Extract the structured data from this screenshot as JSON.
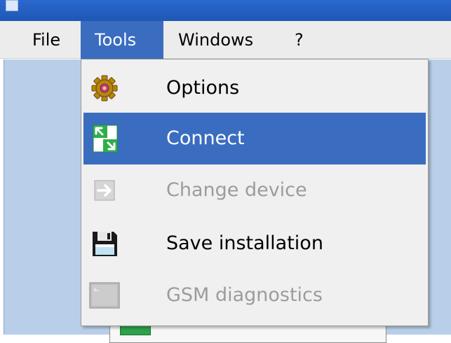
{
  "menubar": {
    "items": [
      {
        "label": "File"
      },
      {
        "label": "Tools"
      },
      {
        "label": "Windows"
      },
      {
        "label": "?"
      }
    ]
  },
  "tools_menu": {
    "items": [
      {
        "label": "Options",
        "icon": "gear-icon",
        "enabled": true,
        "selected": false
      },
      {
        "label": "Connect",
        "icon": "connect-icon",
        "enabled": true,
        "selected": true
      },
      {
        "label": "Change device",
        "icon": "arrow-right-icon",
        "enabled": false,
        "selected": false
      },
      {
        "label": "Save installation",
        "icon": "floppy-disk-icon",
        "enabled": true,
        "selected": false
      },
      {
        "label": "GSM diagnostics",
        "icon": "terminal-icon",
        "enabled": false,
        "selected": false
      }
    ]
  },
  "colors": {
    "selection": "#3a6dc0",
    "menu_background": "#f0f0f0",
    "disabled_text": "#9c9c9c",
    "workspace": "#b9cfe9",
    "titlebar": "#2a68cf"
  }
}
